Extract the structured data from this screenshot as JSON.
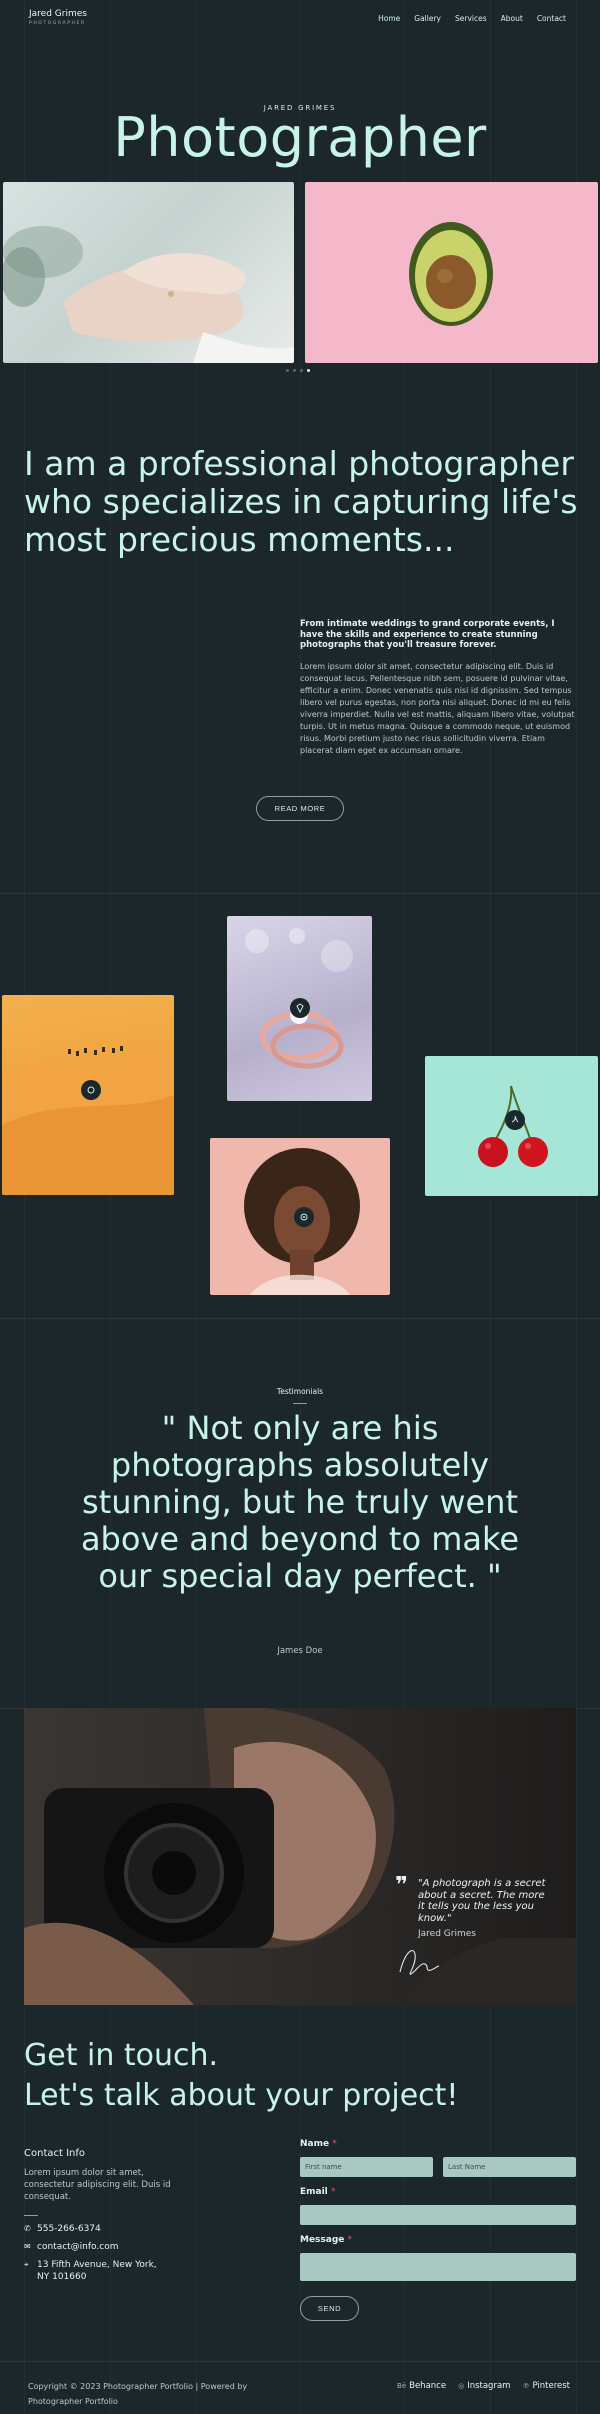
{
  "header": {
    "brand_name": "Jared Grimes",
    "brand_sub": "PHOTOGRAPHER",
    "nav": [
      "Home",
      "Gallery",
      "Services",
      "About",
      "Contact"
    ],
    "active_nav": "Home"
  },
  "hero": {
    "kicker": "JARED GRIMES",
    "title": "Photographer",
    "slides_count": 4,
    "active_slide": 4
  },
  "intro": {
    "lead": "I am a professional photographer who specializes in capturing life's most precious moments...",
    "strong": "From intimate weddings to grand corporate events, I have the skills and experience to create stunning photographs that you'll treasure forever.",
    "body": "Lorem ipsum dolor sit amet, consectetur adipiscing elit. Duis id consequat lacus. Pellentesque nibh sem, posuere id pulvinar vitae, efficitur a enim. Donec venenatis quis nisi id dignissim. Sed tempus libero vel purus egestas, non porta nisi aliquet. Donec id mi eu felis viverra imperdiet. Nulla vel est mattis, aliquam libero vitae, volutpat turpis. Ut in metus magna. Quisque a commodo neque, ut euismod risus. Morbi pretium justo nec risus sollicitudin viverra. Etiam placerat diam eget ex accumsan ornare.",
    "button": "READ MORE"
  },
  "testimonials": {
    "label": "Testimonials",
    "quote": "\" Not only are his photographs absolutely stunning, but he truly went above and beyond to make our special day perfect. \"",
    "author": "James Doe"
  },
  "feature": {
    "quote": "\"A photograph is a secret about a secret. The more it tells you the less you know.\"",
    "author": "Jared Grimes",
    "quote_mark": "❞"
  },
  "contact": {
    "title_line1": "Get in touch.",
    "title_line2": "Let's talk about your project!",
    "info_title": "Contact Info",
    "info_text": "Lorem ipsum dolor sit amet, consectetur adipiscing elit. Duis id consequat.",
    "phone": "555-266-6374",
    "email": "contact@info.com",
    "address_line1": "13 Fifth Avenue, New York,",
    "address_line2": "NY 101660",
    "form": {
      "name_label": "Name",
      "required_mark": "*",
      "first_placeholder": "First name",
      "last_placeholder": "Last Name",
      "email_label": "Email",
      "message_label": "Message",
      "send_label": "SEND"
    }
  },
  "footer": {
    "copyright_line1": "Copyright © 2023 Photographer Portfolio | Powered by",
    "copyright_line2": "Photographer Portfolio",
    "social": [
      "Behance",
      "Instagram",
      "Pinterest"
    ],
    "social_glyphs": [
      "Bē",
      "◎",
      "℗"
    ]
  },
  "colors": {
    "background": "#1c272c",
    "accent_mint": "#c8f3e7",
    "input_fill": "#a9c8c1"
  }
}
